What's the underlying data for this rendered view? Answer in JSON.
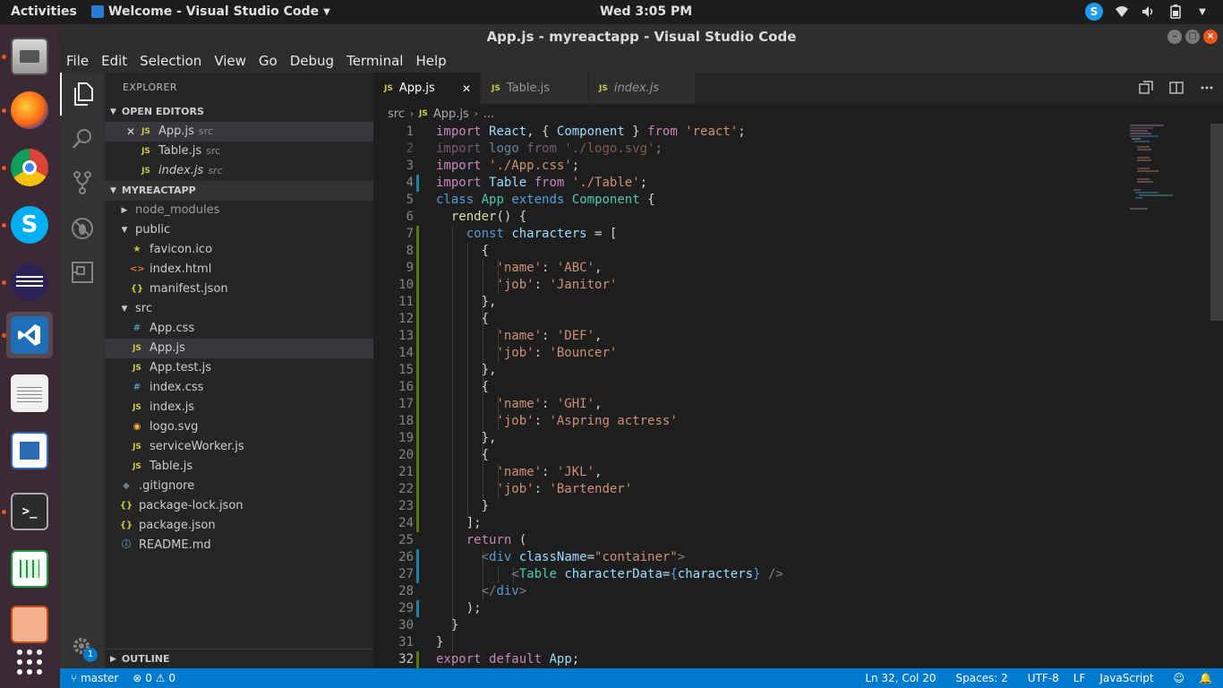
{
  "topbar": {
    "activities": "Activities",
    "app_name": "Welcome - Visual Studio Code",
    "clock": "Wed  3:05 PM"
  },
  "window": {
    "title": "App.js - myreactapp - Visual Studio Code"
  },
  "menu": [
    "File",
    "Edit",
    "Selection",
    "View",
    "Go",
    "Debug",
    "Terminal",
    "Help"
  ],
  "sidebar": {
    "title": "EXPLORER",
    "open_editors_label": "OPEN EDITORS",
    "open_editors": [
      {
        "name": "App.js",
        "dir": "src"
      },
      {
        "name": "Table.js",
        "dir": "src"
      },
      {
        "name": "index.js",
        "dir": "src"
      }
    ],
    "project_label": "MYREACTAPP",
    "outline_label": "OUTLINE",
    "tree": {
      "node_modules": "node_modules",
      "public": "public",
      "public_files": [
        "favicon.ico",
        "index.html",
        "manifest.json"
      ],
      "src": "src",
      "src_files": [
        "App.css",
        "App.js",
        "App.test.js",
        "index.css",
        "index.js",
        "logo.svg",
        "serviceWorker.js",
        "Table.js"
      ],
      "root_files": [
        ".gitignore",
        "package-lock.json",
        "package.json",
        "README.md"
      ]
    },
    "settings_badge": "1"
  },
  "tabs": [
    {
      "label": "App.js",
      "badge": "JS"
    },
    {
      "label": "Table.js",
      "badge": "JS"
    },
    {
      "label": "index.js",
      "badge": "JS"
    }
  ],
  "breadcrumb": {
    "folder": "src",
    "file": "App.js",
    "more": "..."
  },
  "editor": {
    "current_line": 32,
    "line_numbers": [
      "1",
      "2",
      "3",
      "4",
      "5",
      "6",
      "7",
      "8",
      "9",
      "10",
      "11",
      "12",
      "13",
      "14",
      "15",
      "16",
      "17",
      "18",
      "19",
      "20",
      "21",
      "22",
      "23",
      "24",
      "25",
      "26",
      "27",
      "28",
      "29",
      "30",
      "31",
      "32"
    ]
  },
  "statusbar": {
    "branch": "master",
    "errors": "0",
    "warnings": "0",
    "position": "Ln 32, Col 20",
    "spaces": "Spaces: 2",
    "encoding": "UTF-8",
    "eol": "LF",
    "language": "JavaScript"
  },
  "colors": {
    "accent": "#007acc",
    "activity_bar": "#333333",
    "sidebar": "#252526",
    "editor_bg": "#1e1e1e",
    "dock": "#3b2a33"
  }
}
